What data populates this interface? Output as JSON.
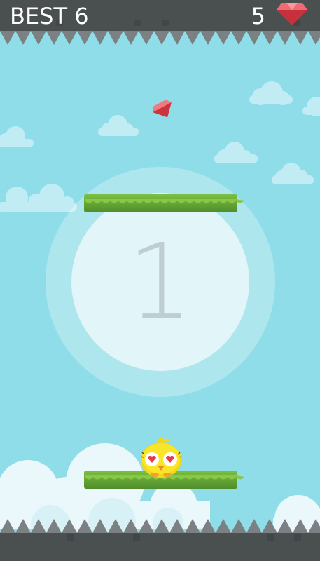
{
  "hud": {
    "best_label": "BEST 6",
    "gem_count": "5",
    "gem_icon": "red-gem-icon"
  },
  "countdown": {
    "value": "1"
  },
  "colors": {
    "sky": "#8fdde8",
    "ceiling": "#4a4f50",
    "spike": "#7b8082",
    "grass_top": "#83c341",
    "grass_dark": "#4e8a2a",
    "bird_body": "#f7de1c",
    "gem": "#e84b55"
  }
}
